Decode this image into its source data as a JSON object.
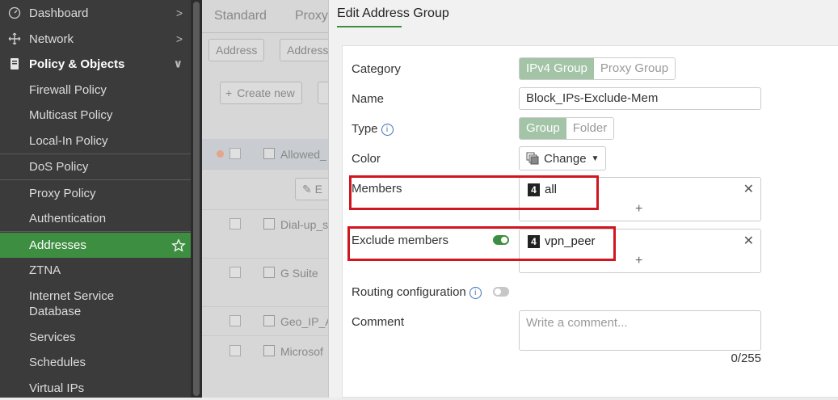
{
  "sidebar": {
    "items": [
      {
        "label": "Dashboard",
        "icon": "gauge-icon"
      },
      {
        "label": "Network",
        "icon": "network-icon"
      },
      {
        "label": "Policy & Objects",
        "icon": "policy-icon"
      },
      {
        "label": "Firewall Policy"
      },
      {
        "label": "Multicast Policy"
      },
      {
        "label": "Local-In Policy"
      },
      {
        "label": "DoS Policy"
      },
      {
        "label": "Proxy Policy"
      },
      {
        "label": "Authentication"
      },
      {
        "label": "Addresses"
      },
      {
        "label": "ZTNA"
      },
      {
        "label": "Internet Service Database"
      },
      {
        "label": "Services"
      },
      {
        "label": "Schedules"
      },
      {
        "label": "Virtual IPs"
      }
    ]
  },
  "background": {
    "tabs": [
      "Standard",
      "Proxy"
    ],
    "filters": [
      "Address",
      "Address"
    ],
    "create_new": "Create new",
    "edit": "E",
    "rows": [
      "Allowed_",
      "Dial-up_s",
      "G Suite",
      "Geo_IP_A",
      "Microsof"
    ]
  },
  "panel": {
    "title": "Edit Address Group",
    "category_label": "Category",
    "category_options": [
      "IPv4 Group",
      "Proxy Group"
    ],
    "name_label": "Name",
    "name_value": "Block_IPs-Exclude-Mem",
    "type_label": "Type",
    "type_options": [
      "Group",
      "Folder"
    ],
    "color_label": "Color",
    "color_button": "Change",
    "members_label": "Members",
    "members": [
      "all"
    ],
    "exclude_label": "Exclude members",
    "exclude_members": [
      "vpn_peer"
    ],
    "routing_label": "Routing configuration",
    "comment_label": "Comment",
    "comment_placeholder": "Write a comment...",
    "comment_counter": "0/255",
    "badge_text": "4"
  },
  "colors": {
    "accent": "#3e8e41",
    "highlight": "#d0161e",
    "selected_toggle": "#a3c4a6"
  }
}
